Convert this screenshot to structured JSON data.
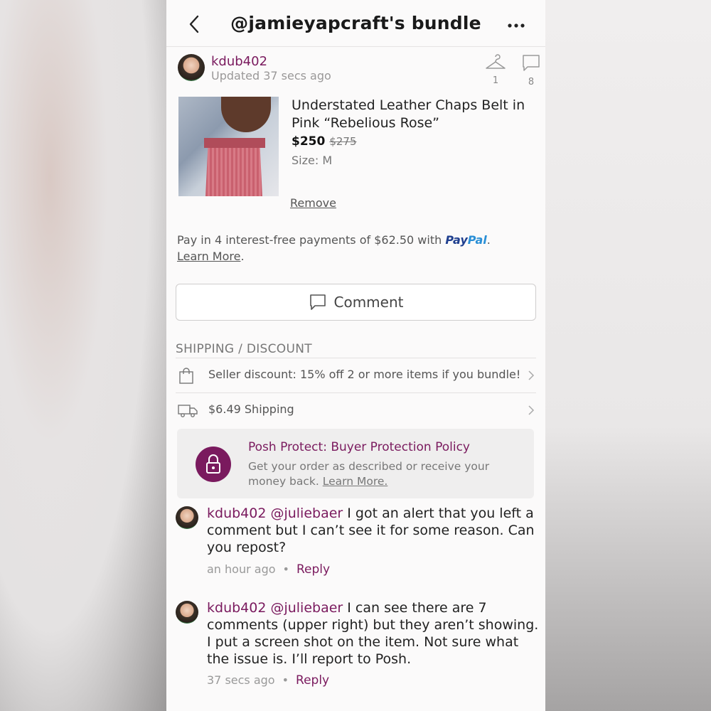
{
  "header": {
    "title": "@jamieyapcraft's bundle"
  },
  "seller": {
    "username": "kdub402",
    "updated": "Updated 37 secs ago",
    "likes_count": "1",
    "comments_count": "8"
  },
  "product": {
    "title": "Understated Leather Chaps Belt in Pink “Rebelious Rose”",
    "price": "$250",
    "original_price": "$275",
    "size": "Size: M",
    "remove_label": "Remove"
  },
  "paypal": {
    "text": "Pay in 4 interest-free payments of $62.50 with ",
    "brand_pay": "Pay",
    "brand_pal": "Pal",
    "period": ".",
    "learn_more": "Learn More",
    "learn_more_suffix": "."
  },
  "comment_button": {
    "label": "Comment"
  },
  "shipping_section": {
    "heading": "SHIPPING / DISCOUNT",
    "discount_text": "Seller discount: 15% off 2 or more items if you bundle!",
    "shipping_text": "$6.49 Shipping"
  },
  "posh_protect": {
    "title": "Posh Protect: Buyer Protection Policy",
    "description": "Get your order as described or receive your money back. ",
    "learn_more": "Learn More."
  },
  "comments": [
    {
      "username": "kdub402",
      "mention": "@juliebaer",
      "text": " I got an alert that you left a comment but I can’t see it for some reason.  Can you repost?",
      "time": "an hour ago",
      "dot": "•",
      "reply_label": "Reply"
    },
    {
      "username": "kdub402",
      "mention": "@juliebaer",
      "text": " I can see there are 7 comments (upper right) but they aren’t showing.  I put a screen shot on the item. Not sure what the issue is.  I’ll report to Posh.",
      "time": "37 secs ago",
      "dot": "•",
      "reply_label": "Reply"
    }
  ],
  "colors": {
    "brand": "#7a1a5e",
    "paypal_dark": "#1f3f8f",
    "paypal_light": "#2a8fd6"
  },
  "icons": {
    "back": "chevron-left-icon",
    "more": "more-dots-icon",
    "likes": "hanger-icon",
    "comments": "speech-bubble-icon",
    "discount": "shopping-bag-icon",
    "shipping": "truck-icon",
    "protect": "lock-icon"
  }
}
